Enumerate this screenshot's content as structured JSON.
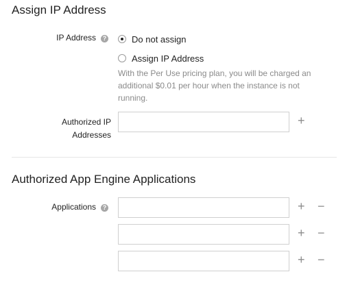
{
  "ip_section": {
    "title": "Assign IP Address",
    "ip_label": "IP Address",
    "options": [
      "Do not assign",
      "Assign IP Address"
    ],
    "selected": "Do not assign",
    "note": "With the Per Use pricing plan, you will be charged an additional $0.01 per hour when the instance is not running.",
    "authorized_label": "Authorized IP Addresses",
    "authorized_value": ""
  },
  "app_section": {
    "title": "Authorized App Engine Applications",
    "label": "Applications",
    "fields": [
      "",
      "",
      ""
    ]
  },
  "icons": {
    "help": "?",
    "plus": "+",
    "minus": "−"
  }
}
